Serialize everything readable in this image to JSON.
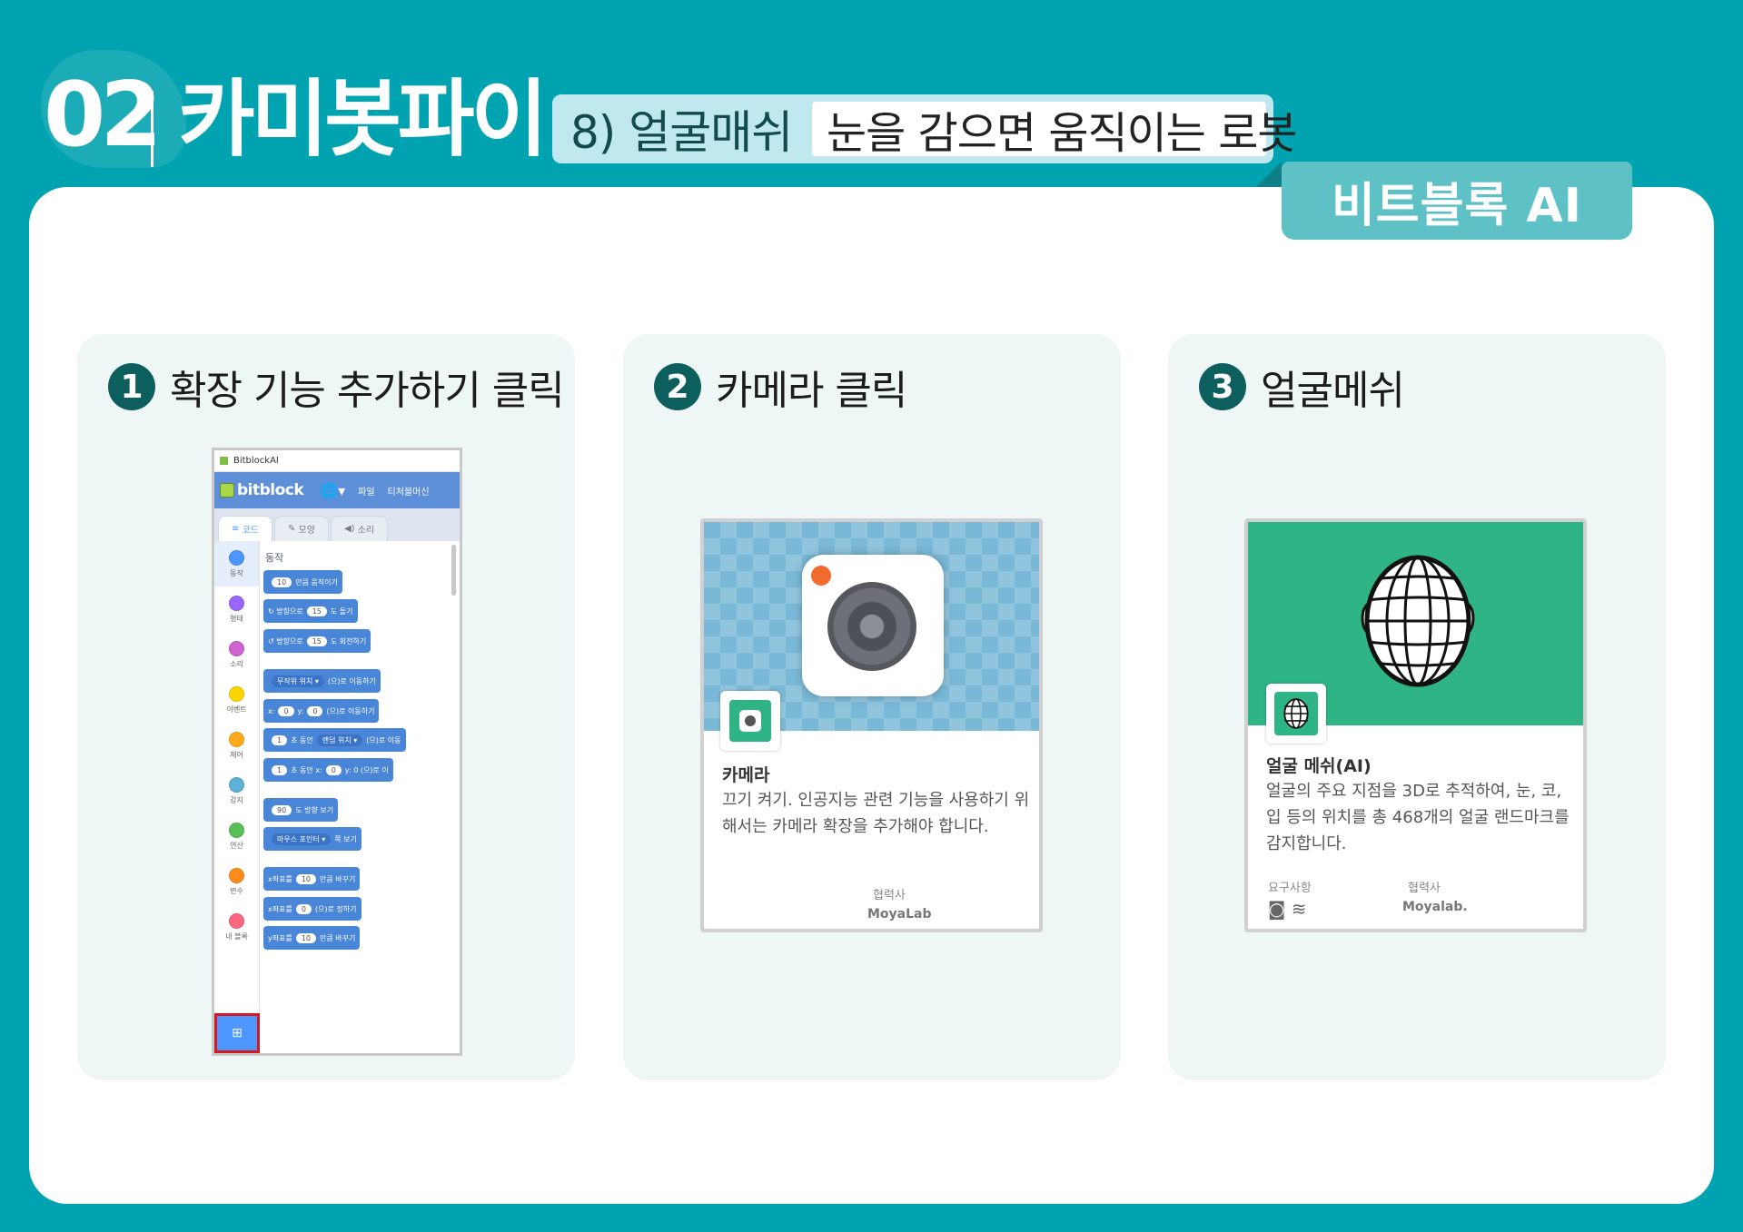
{
  "header": {
    "number": "02",
    "title": "카미봇파이",
    "subtitle_num": "8) 얼굴매쉬",
    "subtitle_desc": "눈을 감으면 움직이는 로봇",
    "tag": "비트블록 AI"
  },
  "steps": [
    {
      "num": "1",
      "label": "확장 기능 추가하기 클릭"
    },
    {
      "num": "2",
      "label": "카메라 클릭"
    },
    {
      "num": "3",
      "label": "얼굴메쉬"
    }
  ],
  "bitblock": {
    "window_title": "BitblockAI",
    "logo": "bitblock",
    "menu_file": "파일",
    "menu_teacher": "티처블머신",
    "tabs": [
      "코드",
      "모양",
      "소리"
    ],
    "categories": [
      {
        "label": "동작",
        "color": "#4c97ff"
      },
      {
        "label": "형태",
        "color": "#9966ff"
      },
      {
        "label": "소리",
        "color": "#cf63cf"
      },
      {
        "label": "이벤트",
        "color": "#ffd500"
      },
      {
        "label": "제어",
        "color": "#ffab19"
      },
      {
        "label": "감지",
        "color": "#5cb1d6"
      },
      {
        "label": "연산",
        "color": "#59c059"
      },
      {
        "label": "변수",
        "color": "#ff8c1a"
      },
      {
        "label": "내 블록",
        "color": "#ff6680"
      }
    ],
    "palette_title": "동작",
    "blocks": [
      {
        "a": "",
        "p1": "10",
        "b": "만큼 움직이기",
        "d": "",
        "c": "",
        "p2": "",
        "e": ""
      },
      {
        "a": "↻ 방향으로",
        "p1": "15",
        "b": "도 돌기",
        "d": "",
        "c": "",
        "p2": "",
        "e": ""
      },
      {
        "a": "↺ 방향으로",
        "p1": "15",
        "b": "도 회전하기",
        "d": "",
        "c": "",
        "p2": "",
        "e": ""
      },
      {
        "a": "",
        "p1": "",
        "b": "",
        "d": "무작위 위치 ▾",
        "c": "(으)로 이동하기",
        "p2": "",
        "e": ""
      },
      {
        "a": "x:",
        "p1": "0",
        "b": "y:",
        "d": "",
        "c": "",
        "p2": "0",
        "e": "(으)로 이동하기"
      },
      {
        "a": "",
        "p1": "1",
        "b": "초 동안",
        "d": "랜덤 위치 ▾",
        "c": "(으)로 이동",
        "p2": "",
        "e": ""
      },
      {
        "a": "",
        "p1": "1",
        "b": "초 동안 x:",
        "d": "",
        "c": "",
        "p2": "0",
        "e": "y: 0 (으)로 이"
      },
      {
        "a": "",
        "p1": "90",
        "b": "도 방향 보기",
        "d": "",
        "c": "",
        "p2": "",
        "e": ""
      },
      {
        "a": "",
        "p1": "",
        "b": "",
        "d": "마우스 포인터 ▾",
        "c": "쪽 보기",
        "p2": "",
        "e": ""
      },
      {
        "a": "x좌표를",
        "p1": "10",
        "b": "만큼 바꾸기",
        "d": "",
        "c": "",
        "p2": "",
        "e": ""
      },
      {
        "a": "x좌표를",
        "p1": "0",
        "b": "(으)로 정하기",
        "d": "",
        "c": "",
        "p2": "",
        "e": ""
      },
      {
        "a": "y좌표를",
        "p1": "10",
        "b": "만큼 바꾸기",
        "d": "",
        "c": "",
        "p2": "",
        "e": ""
      }
    ]
  },
  "camera_card": {
    "name": "카메라",
    "desc": "끄기 켜기. 인공지능 관련 기능을 사용하기 위해서는 카메라 확장을 추가해야 합니다.",
    "partner_label": "협력사",
    "partner": "MoyaLab"
  },
  "face_card": {
    "name": "얼굴 메쉬(AI)",
    "desc": "얼굴의 주요 지점을 3D로 추적하여, 눈, 코, 입 등의 위치를 총 468개의 얼굴 랜드마크를 감지합니다.",
    "req_label": "요구사항",
    "partner_label": "협력사",
    "partner": "Moyalab."
  },
  "colors": {
    "background": "#02a3b0",
    "tag": "#5dc1c6",
    "card": "#eef7f6",
    "step_circle": "#0d5f5e",
    "green": "#2fb486"
  }
}
